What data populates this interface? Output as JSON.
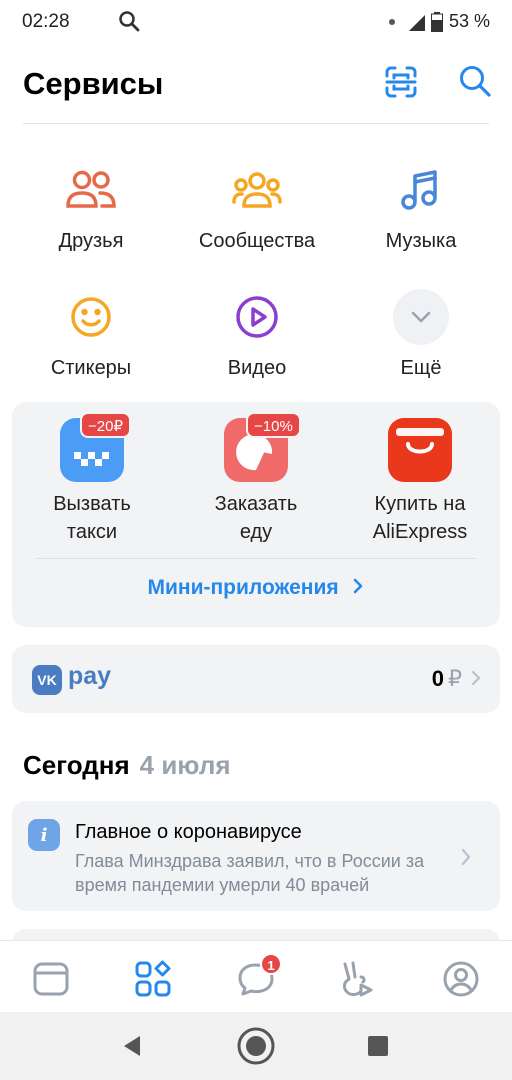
{
  "status": {
    "time": "02:28",
    "battery": "53 %"
  },
  "header": {
    "title": "Сервисы"
  },
  "services": [
    {
      "label": "Друзья",
      "icon": "friends-icon"
    },
    {
      "label": "Сообщества",
      "icon": "communities-icon"
    },
    {
      "label": "Музыка",
      "icon": "music-icon"
    },
    {
      "label": "Стикеры",
      "icon": "stickers-icon"
    },
    {
      "label": "Видео",
      "icon": "video-icon"
    },
    {
      "label": "Ещё",
      "icon": "chevron-down-icon"
    }
  ],
  "mini_apps": {
    "items": [
      {
        "label": "Вызвать\nтакси",
        "badge": "−20₽",
        "icon": "taxi-icon"
      },
      {
        "label": "Заказать\nеду",
        "badge": "−10%",
        "icon": "food-icon"
      },
      {
        "label": "Купить на\nAliExpress",
        "badge": "",
        "icon": "shopping-bag-icon"
      }
    ],
    "link": "Мини-приложения"
  },
  "pay": {
    "logo_text": "VK",
    "label": "pay",
    "amount": "0",
    "currency": "₽"
  },
  "today": {
    "title": "Сегодня",
    "date": "4 июля"
  },
  "news": {
    "title": "Главное о коронавирусе",
    "text": "Глава Минздрава заявил, что в России за время пандемии умерли 40 врачей"
  },
  "tabbar": {
    "messages_badge": "1"
  },
  "colors": {
    "accent": "#2688eb",
    "badge_red": "#e64646",
    "card_bg": "#f2f3f5"
  }
}
